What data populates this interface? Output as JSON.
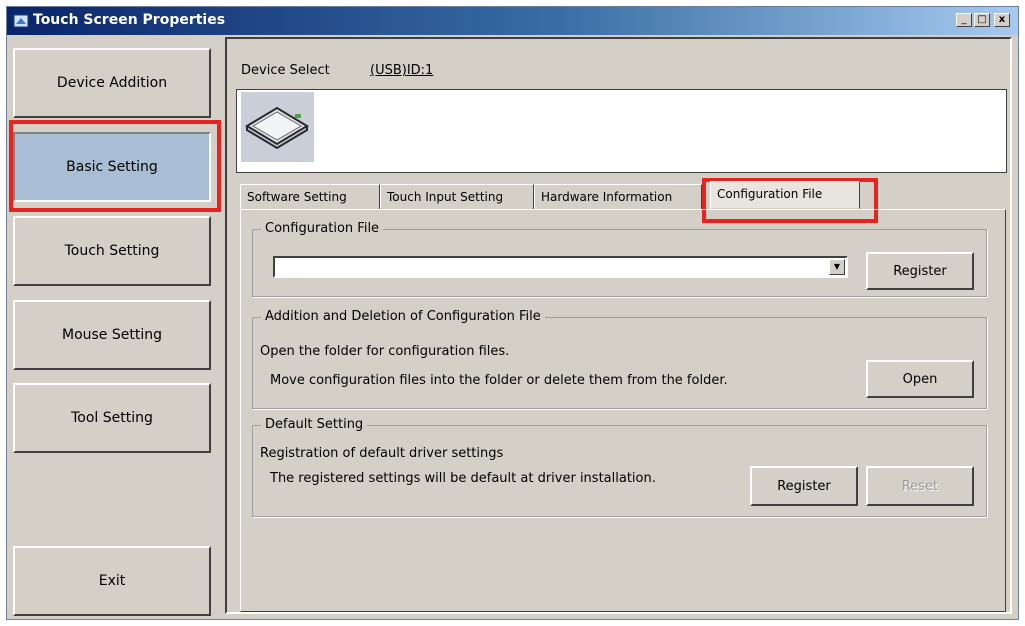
{
  "window": {
    "title": "Touch Screen Properties",
    "controls": {
      "minimize": "_",
      "maximize": "□",
      "close": "x"
    }
  },
  "nav": [
    {
      "label": "Device Addition"
    },
    {
      "label": "Basic Setting"
    },
    {
      "label": "Touch Setting"
    },
    {
      "label": "Mouse Setting"
    },
    {
      "label": "Tool Setting"
    },
    {
      "label": "Exit"
    }
  ],
  "device_select": {
    "label": "Device Select",
    "value": "(USB)ID:1",
    "icon": "touch-panel-icon"
  },
  "tabs": [
    {
      "label": "Software Setting"
    },
    {
      "label": "Touch Input Setting"
    },
    {
      "label": "Hardware Information"
    },
    {
      "label": "Configuration File",
      "selected": true
    }
  ],
  "config_file": {
    "legend": "Configuration File",
    "combo_value": "",
    "combo_arrow": "▼",
    "register_label": "Register"
  },
  "add_delete": {
    "legend": "Addition and Deletion of Configuration File",
    "line1": "Open the folder for configuration files.",
    "line2": "Move configuration files into the folder or delete them from the folder.",
    "open_label": "Open"
  },
  "default_setting": {
    "legend": "Default Setting",
    "line1": "Registration of default driver settings",
    "line2": "The registered settings will be default at driver installation.",
    "register_label": "Register",
    "reset_label": "Reset"
  },
  "colors": {
    "highlight": "#e8231f",
    "active_nav": "#a9bdd4",
    "face": "#d4d0c8"
  }
}
